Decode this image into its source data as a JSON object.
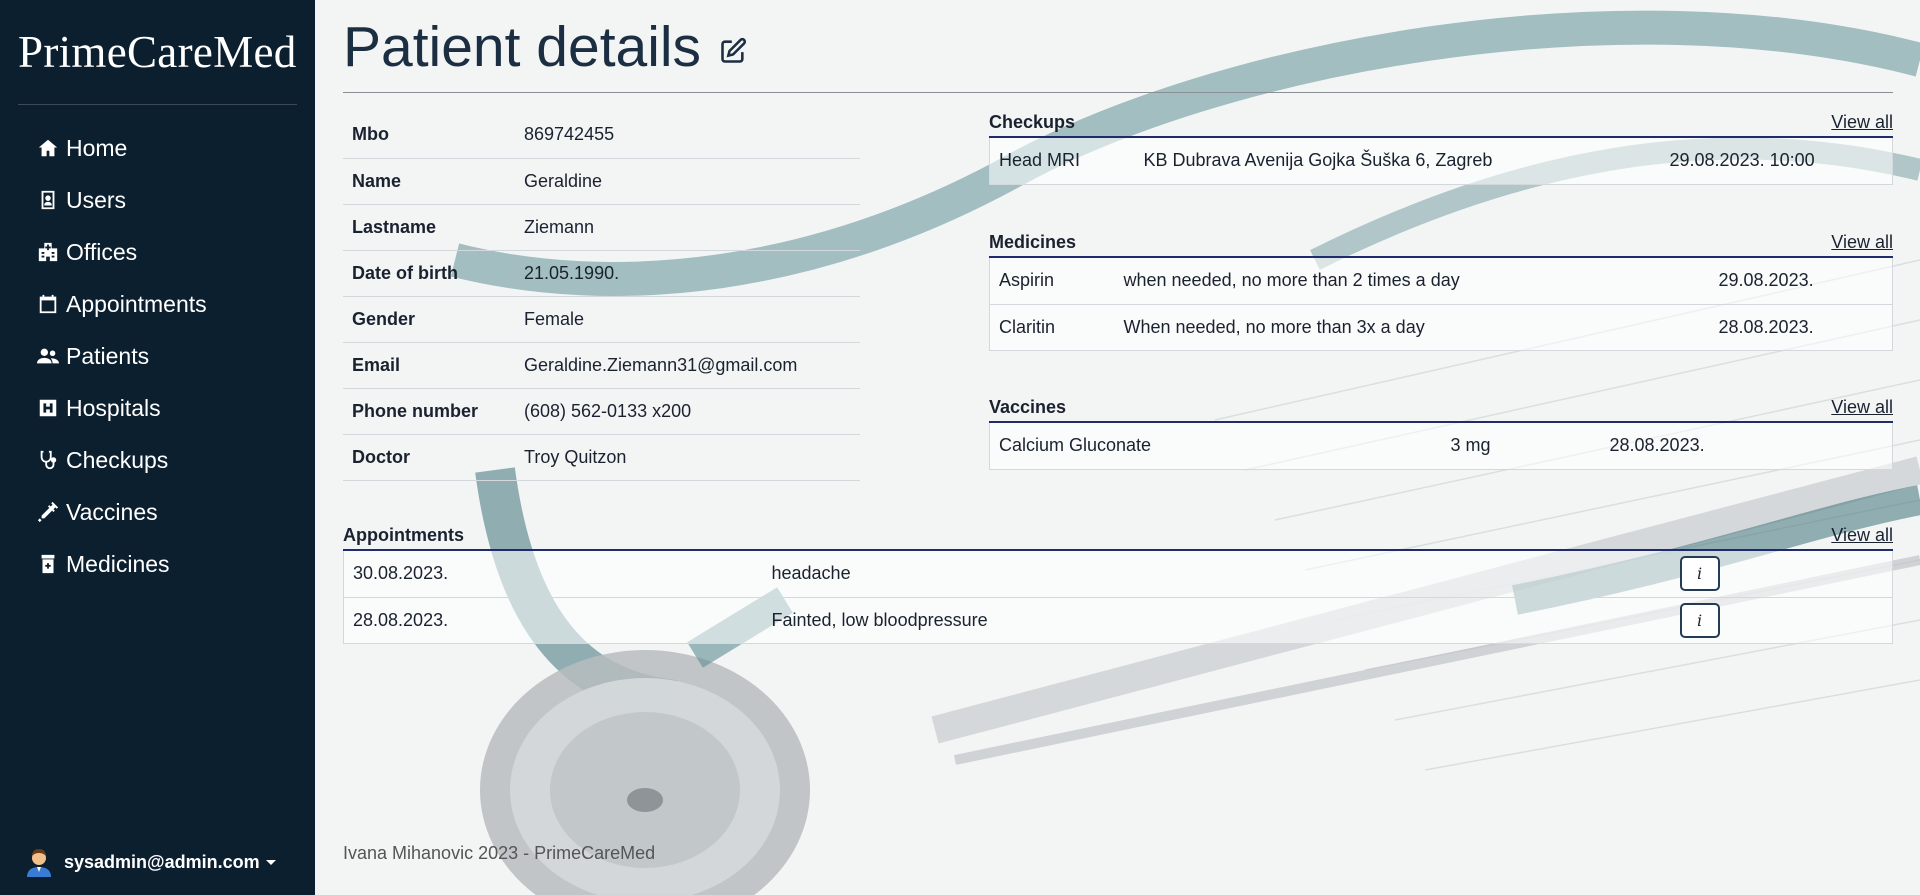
{
  "brand": "PrimeCareMed",
  "nav": [
    {
      "label": "Home",
      "icon": "home-icon"
    },
    {
      "label": "Users",
      "icon": "id-badge-icon"
    },
    {
      "label": "Offices",
      "icon": "clinic-icon"
    },
    {
      "label": "Appointments",
      "icon": "calendar-icon"
    },
    {
      "label": "Patients",
      "icon": "users-icon"
    },
    {
      "label": "Hospitals",
      "icon": "hospital-h-icon"
    },
    {
      "label": "Checkups",
      "icon": "stethoscope-icon"
    },
    {
      "label": "Vaccines",
      "icon": "syringe-icon"
    },
    {
      "label": "Medicines",
      "icon": "medicine-bottle-icon"
    }
  ],
  "user": {
    "email": "sysadmin@admin.com"
  },
  "page": {
    "title": "Patient details"
  },
  "patient": {
    "labels": {
      "mbo": "Mbo",
      "name": "Name",
      "lastname": "Lastname",
      "dob": "Date of birth",
      "gender": "Gender",
      "email": "Email",
      "phone": "Phone number",
      "doctor": "Doctor"
    },
    "values": {
      "mbo": "869742455",
      "name": "Geraldine",
      "lastname": "Ziemann",
      "dob": "21.05.1990.",
      "gender": "Female",
      "email": "Geraldine.Ziemann31@gmail.com",
      "phone": "(608) 562-0133 x200",
      "doctor": "Troy Quitzon"
    }
  },
  "checkups": {
    "title": "Checkups",
    "view_all": "View all",
    "rows": [
      {
        "name": "Head MRI",
        "location": "KB Dubrava Avenija Gojka Šuška 6, Zagreb",
        "date": "29.08.2023. 10:00"
      }
    ]
  },
  "medicines": {
    "title": "Medicines",
    "view_all": "View all",
    "rows": [
      {
        "name": "Aspirin",
        "usage": "when needed, no more than 2 times a day",
        "date": "29.08.2023."
      },
      {
        "name": "Claritin",
        "usage": "When needed, no more than 3x a day",
        "date": "28.08.2023."
      }
    ]
  },
  "vaccines": {
    "title": "Vaccines",
    "view_all": "View all",
    "rows": [
      {
        "name": "Calcium Gluconate",
        "dose": "3 mg",
        "date": "28.08.2023."
      }
    ]
  },
  "appointments": {
    "title": "Appointments",
    "view_all": "View all",
    "info_label": "i",
    "rows": [
      {
        "date": "30.08.2023.",
        "reason": "headache"
      },
      {
        "date": "28.08.2023.",
        "reason": "Fainted, low bloodpressure"
      }
    ]
  },
  "footer": "Ivana Mihanovic 2023 - PrimeCareMed",
  "colors": {
    "sidebar": "#0c1f2f",
    "accent": "#202b6e",
    "title": "#1c2e42"
  }
}
